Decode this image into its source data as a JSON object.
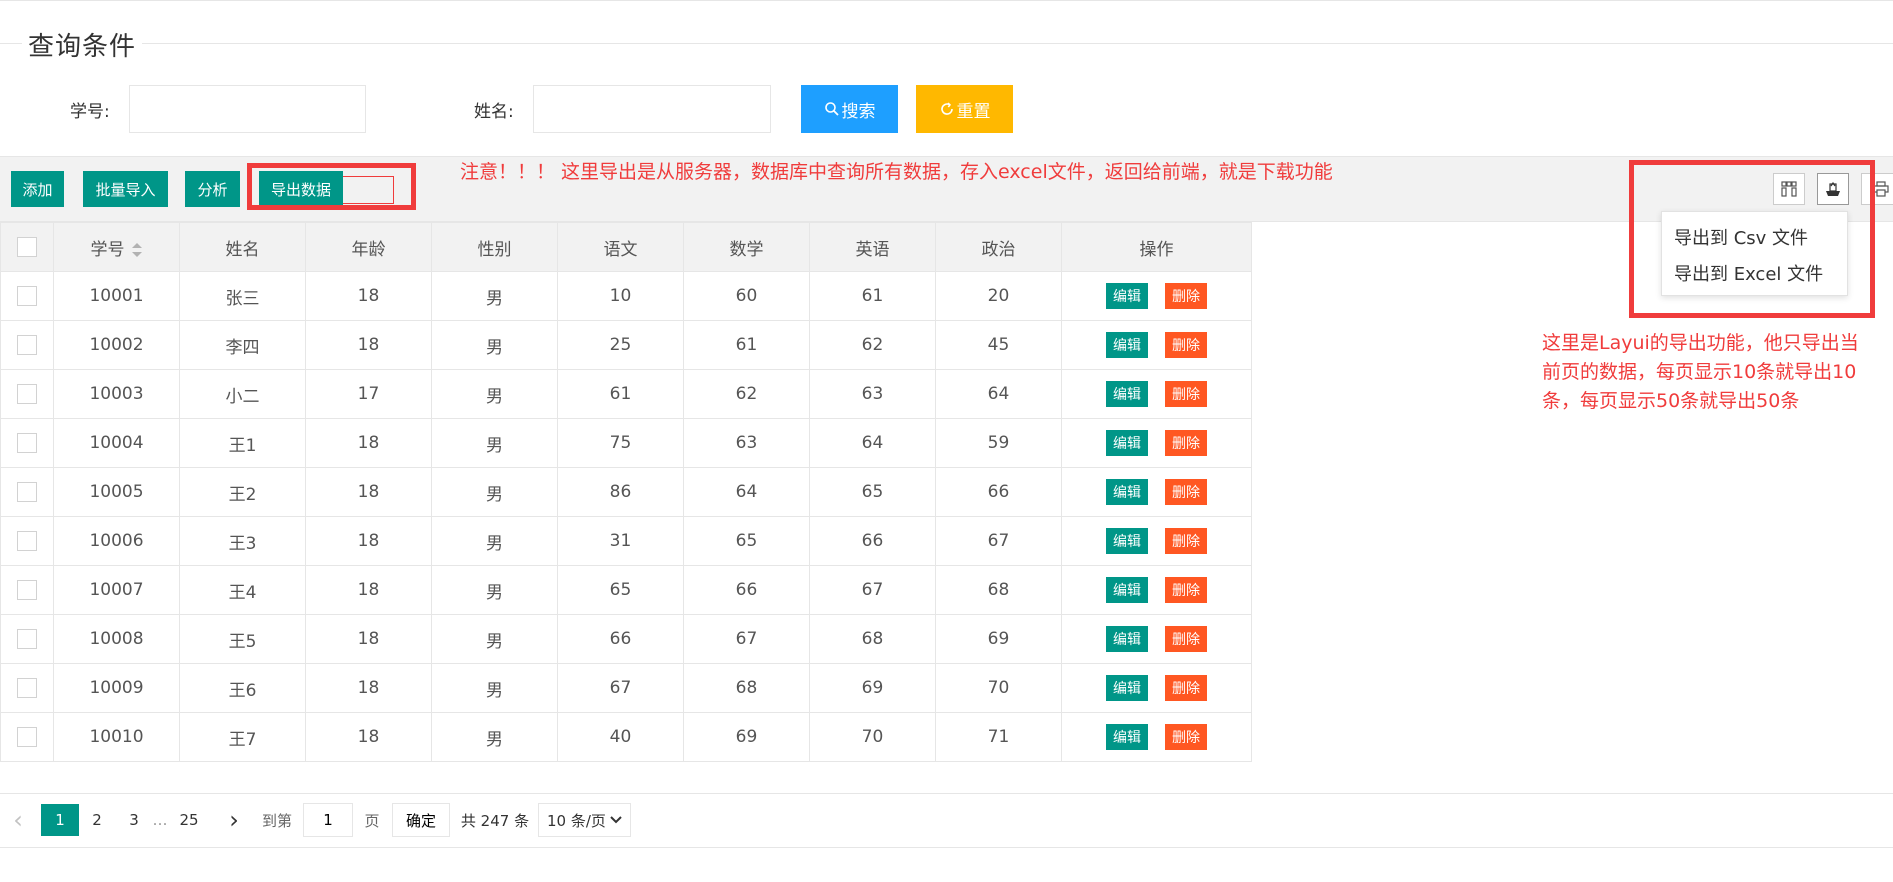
{
  "fieldset": {
    "title": "查询条件"
  },
  "search": {
    "student_id_label": "学号:",
    "student_id_value": "",
    "name_label": "姓名:",
    "name_value": "",
    "search_label": "搜索",
    "reset_label": "重置"
  },
  "toolbar": {
    "add_label": "添加",
    "batch_import_label": "批量导入",
    "analyze_label": "分析",
    "export_label": "导出数据",
    "icons": [
      "columns-icon",
      "export-icon",
      "print-icon"
    ]
  },
  "export_menu": {
    "items": [
      {
        "label": "导出到 Csv 文件"
      },
      {
        "label": "导出到 Excel 文件"
      }
    ]
  },
  "table": {
    "columns": [
      "学号",
      "姓名",
      "年龄",
      "性别",
      "语文",
      "数学",
      "英语",
      "政治",
      "操作"
    ],
    "rows": [
      [
        "10001",
        "张三",
        "18",
        "男",
        "10",
        "60",
        "61",
        "20"
      ],
      [
        "10002",
        "李四",
        "18",
        "男",
        "25",
        "61",
        "62",
        "45"
      ],
      [
        "10003",
        "小二",
        "17",
        "男",
        "61",
        "62",
        "63",
        "64"
      ],
      [
        "10004",
        "王1",
        "18",
        "男",
        "75",
        "63",
        "64",
        "59"
      ],
      [
        "10005",
        "王2",
        "18",
        "男",
        "86",
        "64",
        "65",
        "66"
      ],
      [
        "10006",
        "王3",
        "18",
        "男",
        "31",
        "65",
        "66",
        "67"
      ],
      [
        "10007",
        "王4",
        "18",
        "男",
        "65",
        "66",
        "67",
        "68"
      ],
      [
        "10008",
        "王5",
        "18",
        "男",
        "66",
        "67",
        "68",
        "69"
      ],
      [
        "10009",
        "王6",
        "18",
        "男",
        "67",
        "68",
        "69",
        "70"
      ],
      [
        "10010",
        "王7",
        "18",
        "男",
        "40",
        "69",
        "70",
        "71"
      ]
    ],
    "edit_label": "编辑",
    "delete_label": "删除"
  },
  "pager": {
    "prev": "‹",
    "pages": [
      "1",
      "2",
      "3",
      "…",
      "25"
    ],
    "current": "1",
    "next": "›",
    "goto_label": "到第",
    "goto_value": "1",
    "page_unit": "页",
    "confirm_label": "确定",
    "total_text": "共 247 条",
    "page_size": "10 条/页"
  },
  "annotations": {
    "note_top": "注意！！！ 这里导出是从服务器，数据库中查询所有数据，存入excel文件，返回给前端，就是下载功能",
    "note_right": [
      "这里是Layui的导出功能，他只导出当",
      "前页的数据，每页显示10条就导出10",
      "条，每页显示50条就导出50条"
    ]
  },
  "colors": {
    "primary": "#009688",
    "search": "#1e9fff",
    "reset": "#ffb800",
    "danger": "#ff5722",
    "annotation": "#f03c3c"
  }
}
